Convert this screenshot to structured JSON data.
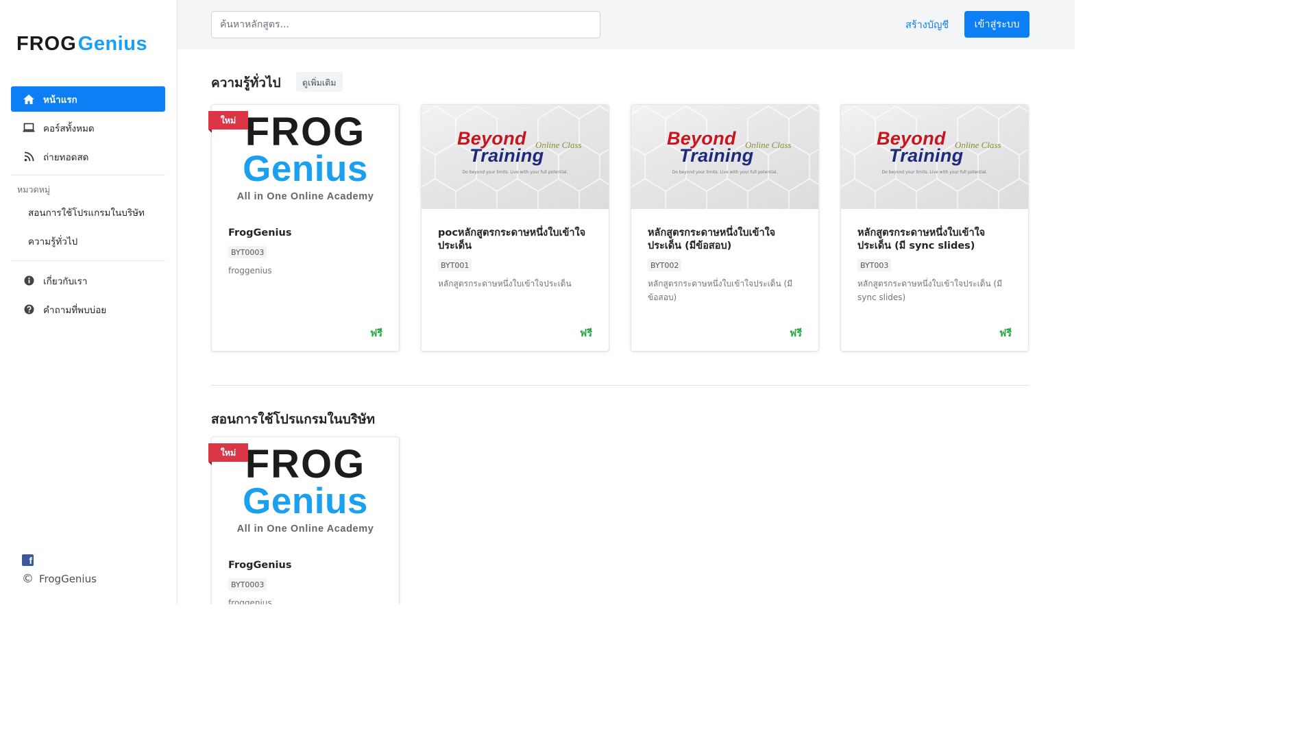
{
  "brand": {
    "logo_part1": "FROG",
    "logo_part2": "Genius",
    "brand_color": "#1aa0f0"
  },
  "sidebar": {
    "nav": [
      {
        "label": "หน้าแรก",
        "icon": "home-icon",
        "active": true
      },
      {
        "label": "คอร์สทั้งหมด",
        "icon": "laptop-icon",
        "active": false
      },
      {
        "label": "ถ่ายทอดสด",
        "icon": "rss-icon",
        "active": false
      }
    ],
    "categories_title": "หมวดหมู่",
    "categories": [
      {
        "label": "สอนการใช้โปรแกรมในบริษัท"
      },
      {
        "label": "ความรู้ทั่วไป"
      }
    ],
    "info": [
      {
        "label": "เกี่ยวกับเรา",
        "icon": "info-circle-icon"
      },
      {
        "label": "คำถามที่พบบ่อย",
        "icon": "question-circle-icon"
      }
    ],
    "footer": {
      "facebook_icon": "facebook-icon",
      "copyright_symbol": "©",
      "copyright_text": "FrogGenius"
    }
  },
  "header": {
    "search_placeholder": "ค้นหาหลักสูตร...",
    "signup_label": "สร้างบัญชี",
    "login_label": "เข้าสู่ระบบ"
  },
  "sections": [
    {
      "title": "ความรู้ทั่วไป",
      "more_label": "ดูเพิ่มเติม",
      "courses": [
        {
          "thumb": "frog",
          "badge": "ใหม่",
          "name": "FrogGenius",
          "code": "BYT0003",
          "desc": "froggenius",
          "price": "ฟรี",
          "thumb_text": {
            "line1": "FROG",
            "line2": "Genius",
            "tagline": "All in One Online Academy"
          }
        },
        {
          "thumb": "beyond",
          "name": "pocหลักสูตรกระดาษหนึ่งใบเข้าใจประเด็น",
          "code": "BYT001",
          "desc": "หลักสูตรกระดาษหนึ่งใบเข้าใจประเด็น",
          "price": "ฟรี",
          "thumb_text": {
            "line1": "Beyond",
            "line2": "Training",
            "online": "Online Class",
            "slogan": "Do beyond your limits. Live with your full potential."
          }
        },
        {
          "thumb": "beyond",
          "name": "หลักสูตรกระดาษหนึ่งใบเข้าใจประเด็น (มีข้อสอบ)",
          "code": "BYT002",
          "desc": "หลักสูตรกระดาษหนึ่งใบเข้าใจประเด็น (มีข้อสอบ)",
          "price": "ฟรี",
          "thumb_text": {
            "line1": "Beyond",
            "line2": "Training",
            "online": "Online Class",
            "slogan": "Do beyond your limits. Live with your full potential."
          }
        },
        {
          "thumb": "beyond",
          "name": "หลักสูตรกระดาษหนึ่งใบเข้าใจประเด็น (มี sync slides)",
          "code": "BYT003",
          "desc": "หลักสูตรกระดาษหนึ่งใบเข้าใจประเด็น (มี sync slides)",
          "price": "ฟรี",
          "thumb_text": {
            "line1": "Beyond",
            "line2": "Training",
            "online": "Online Class",
            "slogan": "Do beyond your limits. Live with your full potential."
          }
        }
      ]
    },
    {
      "title": "สอนการใช้โปรแกรมในบริษัท",
      "courses": [
        {
          "thumb": "frog",
          "badge": "ใหม่",
          "name": "FrogGenius",
          "code": "BYT0003",
          "desc": "froggenius",
          "thumb_text": {
            "line1": "FROG",
            "line2": "Genius",
            "tagline": "All in One Online Academy"
          }
        }
      ]
    }
  ],
  "colors": {
    "primary": "#0d7ff5",
    "free_price": "#28a745",
    "new_badge": "#dc3545"
  }
}
